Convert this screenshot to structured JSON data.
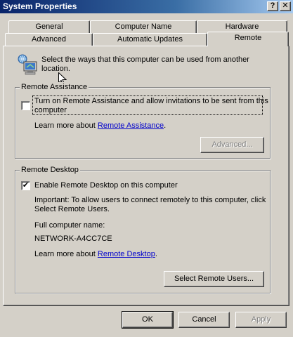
{
  "window": {
    "title": "System Properties",
    "help_label": "?",
    "close_label": "✕"
  },
  "tabs": {
    "row_back": [
      "General",
      "Computer Name",
      "Hardware"
    ],
    "row_front": [
      "Advanced",
      "Automatic Updates",
      "Remote"
    ],
    "active": "Remote"
  },
  "intro": {
    "line1": "Select the ways that this computer can be used from another",
    "line2": "location."
  },
  "remote_assistance": {
    "group_title": "Remote Assistance",
    "checkbox_line1": "Turn on Remote Assistance and allow invitations to be sent from this",
    "checkbox_line2": "computer",
    "checked": false,
    "learn_prefix": "Learn more about",
    "learn_link": "Remote Assistance",
    "learn_suffix": ".",
    "advanced_label": "Advanced..."
  },
  "remote_desktop": {
    "group_title": "Remote Desktop",
    "checkbox_label": "Enable Remote Desktop on this computer",
    "checked": true,
    "check_mark": "✔",
    "important_line1": "Important: To allow users to connect remotely to this computer, click",
    "important_line2": "Select Remote Users.",
    "computer_name_label": "Full computer name:",
    "computer_name_value": "NETWORK-A4CC7CE",
    "learn_prefix": "Learn more about",
    "learn_link": "Remote Desktop",
    "learn_suffix": ".",
    "select_users_label": "Select Remote Users..."
  },
  "footer": {
    "ok_label": "OK",
    "cancel_label": "Cancel",
    "apply_label": "Apply"
  },
  "colors": {
    "titlebar_start": "#0a246a",
    "titlebar_end": "#a6caf0",
    "face": "#d4d0c8",
    "link": "#0000cc"
  }
}
